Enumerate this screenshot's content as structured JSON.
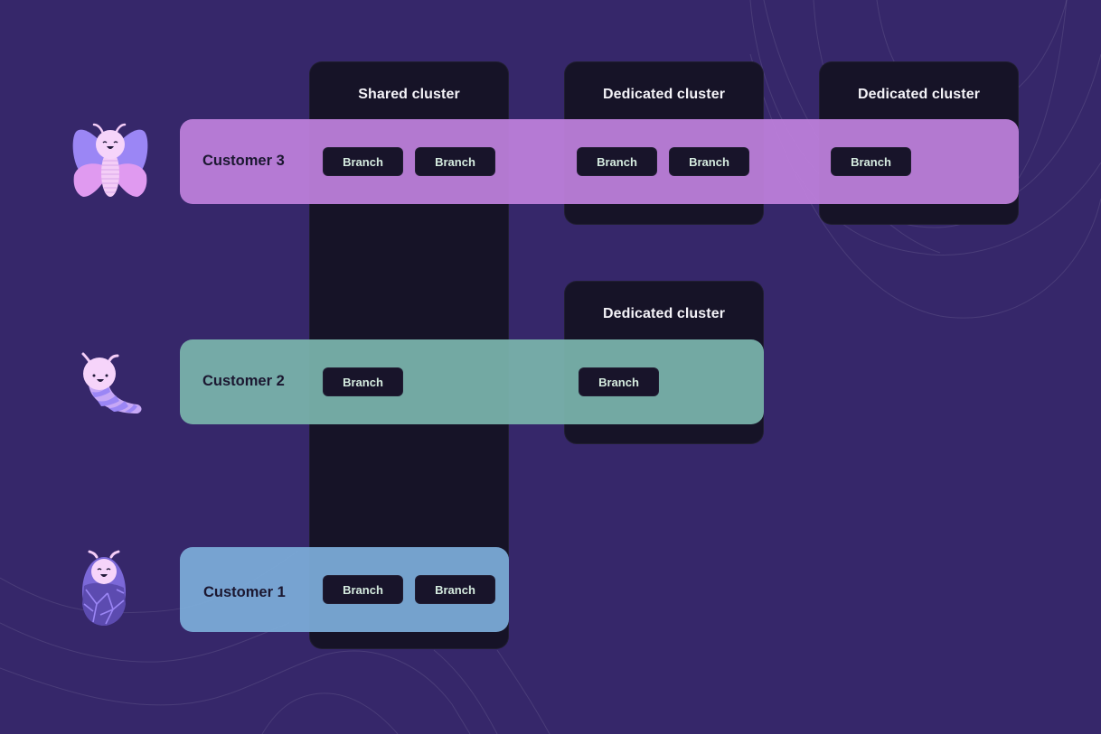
{
  "clusters": {
    "shared": {
      "title": "Shared cluster"
    },
    "dedicated_c3_a": {
      "title": "Dedicated cluster"
    },
    "dedicated_c3_b": {
      "title": "Dedicated cluster"
    },
    "dedicated_c2": {
      "title": "Dedicated cluster"
    }
  },
  "customers": [
    {
      "label": "Customer 3",
      "mascot": "butterfly-icon",
      "color": "#bd80db",
      "branches": {
        "shared": [
          "Branch",
          "Branch"
        ],
        "dedicated_a": [
          "Branch",
          "Branch"
        ],
        "dedicated_b": [
          "Branch"
        ]
      }
    },
    {
      "label": "Customer 2",
      "mascot": "caterpillar-icon",
      "color": "#79b3ab",
      "branches": {
        "shared": [
          "Branch"
        ],
        "dedicated": [
          "Branch"
        ]
      }
    },
    {
      "label": "Customer 1",
      "mascot": "cocoon-icon",
      "color": "#7babd8",
      "branches": {
        "shared": [
          "Branch",
          "Branch"
        ]
      }
    }
  ],
  "colors": {
    "background": "#36276a",
    "cluster": "#161327",
    "branch": "#18142a",
    "branch_text": "#d6ece0"
  }
}
